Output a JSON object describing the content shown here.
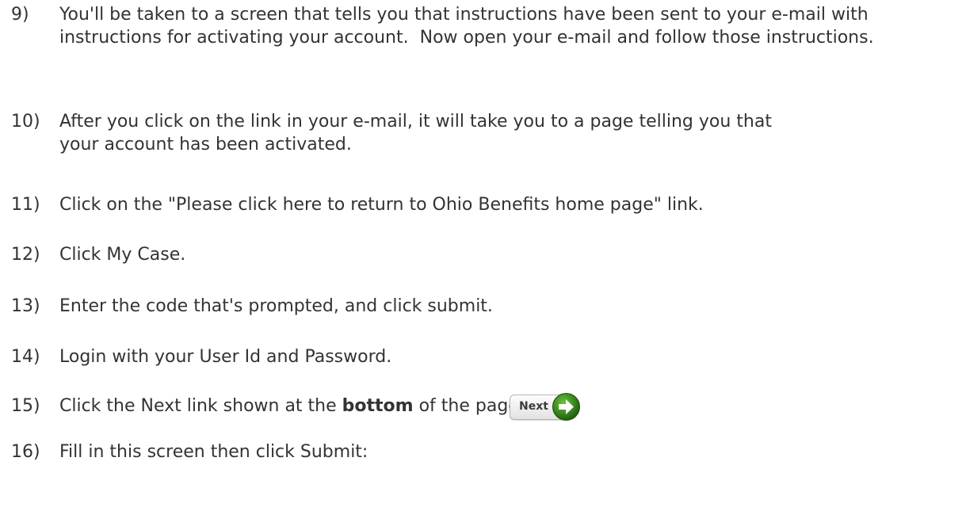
{
  "steps": [
    {
      "num": "9)",
      "text": "You'll be taken to a screen that tells you that instructions have been sent to your e-mail with instructions for activating your account.  Now open your e-mail and follow those instructions."
    },
    {
      "num": "10)",
      "text": "After you click on the link in your e-mail, it will take you to a page telling you that your account has been activated."
    },
    {
      "num": "11)",
      "text": "Click on the \"Please click here to return to Ohio Benefits home page\" link."
    },
    {
      "num": "12)",
      "text": "Click My Case."
    },
    {
      "num": "13)",
      "text": "Enter the code that's prompted, and click submit."
    },
    {
      "num": "14)",
      "text": "Login with your User Id and Password."
    },
    {
      "num": "15)",
      "text_before": "Click the Next link shown at the ",
      "text_bold": "bottom",
      "text_after": " of the page."
    },
    {
      "num": "16)",
      "text": "Fill in this screen then click Submit:"
    }
  ],
  "next_button": {
    "label": "Next",
    "icon": "green-arrow-right-icon",
    "color_green": "#3b8a1f"
  }
}
